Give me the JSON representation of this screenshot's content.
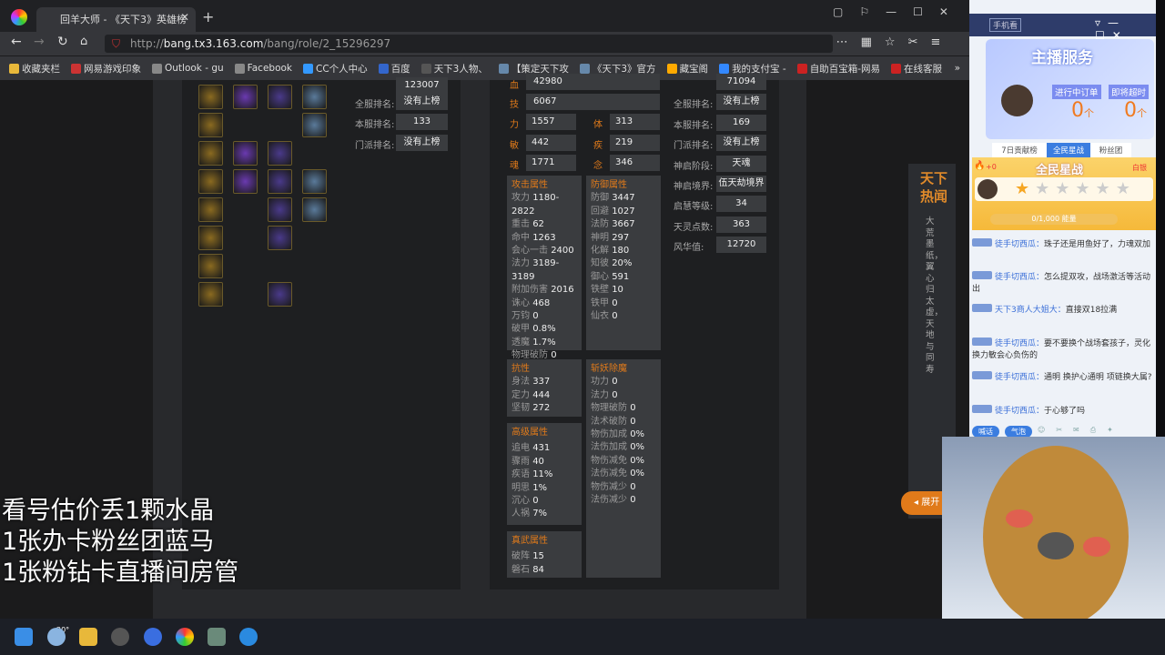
{
  "browser": {
    "tab_title": "回羊大师 - 《天下3》英雄榜",
    "url_prefix": "http://",
    "url_host": "bang.tx3.163.com",
    "url_path": "/bang/role/2_15296297",
    "bookmarks": [
      "收藏夹栏",
      "网易游戏印象",
      "Outlook - gu",
      "Facebook",
      "CC个人中心",
      "百度",
      "天下3人物、",
      "【策定天下攻",
      "《天下3》官方",
      "藏宝阁",
      "我的支付宝 -",
      "自助百宝箱-网易",
      "在线客服"
    ]
  },
  "left_ranks": [
    {
      "label": "",
      "value": "123007"
    },
    {
      "label": "全服排名:",
      "value": "没有上榜"
    },
    {
      "label": "本服排名:",
      "value": "133"
    },
    {
      "label": "门派排名:",
      "value": "没有上榜"
    }
  ],
  "main_stats": {
    "hp": {
      "label": "血",
      "value": "42980"
    },
    "skill": {
      "label": "技",
      "value": "6067"
    },
    "pairs": [
      [
        {
          "label": "力",
          "value": "1557"
        },
        {
          "label": "体",
          "value": "313"
        }
      ],
      [
        {
          "label": "敏",
          "value": "442"
        },
        {
          "label": "疾",
          "value": "219"
        }
      ],
      [
        {
          "label": "魂",
          "value": "1771"
        },
        {
          "label": "念",
          "value": "346"
        }
      ]
    ]
  },
  "right_ranks": [
    {
      "label": "",
      "value": "71094"
    },
    {
      "label": "全服排名:",
      "value": "没有上榜"
    },
    {
      "label": "本服排名:",
      "value": "169"
    },
    {
      "label": "门派排名:",
      "value": "没有上榜"
    },
    {
      "label": "神启阶段:",
      "value": "天魂"
    },
    {
      "label": "神启境界:",
      "value": "伍天劫境界"
    },
    {
      "label": "启慧等级:",
      "value": "34"
    },
    {
      "label": "天灵点数:",
      "value": "363"
    },
    {
      "label": "风华值:",
      "value": "12720"
    }
  ],
  "attack": {
    "title": "攻击属性",
    "rows": [
      [
        "攻力",
        "1180-2822"
      ],
      [
        "重击",
        "62"
      ],
      [
        "命中",
        "1263"
      ],
      [
        "会心一击",
        "2400"
      ],
      [
        "法力",
        "3189-3189"
      ],
      [
        "附加伤害",
        "2016"
      ],
      [
        "诛心",
        "468"
      ],
      [
        "万钧",
        "0"
      ],
      [
        "破甲",
        "0.8%"
      ],
      [
        "透魔",
        "1.7%"
      ],
      [
        "物理破防",
        "0"
      ],
      [
        "法术破防",
        "0"
      ]
    ]
  },
  "defense": {
    "title": "防御属性",
    "rows": [
      [
        "防御",
        "3447"
      ],
      [
        "回避",
        "1027"
      ],
      [
        "法防",
        "3667"
      ],
      [
        "神明",
        "297"
      ],
      [
        "化解",
        "180"
      ],
      [
        "知彼",
        "20%"
      ],
      [
        "御心",
        "591"
      ],
      [
        "铁壁",
        "10"
      ],
      [
        "铁甲",
        "0"
      ],
      [
        "仙衣",
        "0"
      ]
    ]
  },
  "resist": {
    "title": "抗性",
    "rows": [
      [
        "身法",
        "337"
      ],
      [
        "定力",
        "444"
      ],
      [
        "坚韧",
        "272"
      ]
    ]
  },
  "advanced": {
    "title": "高级属性",
    "rows": [
      [
        "追电",
        "431"
      ],
      [
        "骤雨",
        "40"
      ],
      [
        "疾语",
        "11%"
      ],
      [
        "明思",
        "1%"
      ],
      [
        "沉心",
        "0"
      ],
      [
        "人祸",
        "7%"
      ]
    ]
  },
  "zhenwu": {
    "title": "真武属性",
    "rows": [
      [
        "破阵",
        "15"
      ],
      [
        "磐石",
        "84"
      ]
    ]
  },
  "demon": {
    "title": "斩妖除魔",
    "rows": [
      [
        "功力",
        "0"
      ],
      [
        "法力",
        "0"
      ],
      [
        "物理破防",
        "0"
      ],
      [
        "法术破防",
        "0"
      ],
      [
        "物伤加成",
        "0%"
      ],
      [
        "法伤加成",
        "0%"
      ],
      [
        "物伤减免",
        "0%"
      ],
      [
        "法伤减免",
        "0%"
      ],
      [
        "物伤减少",
        "0"
      ],
      [
        "法伤减少",
        "0"
      ]
    ]
  },
  "hot_news": {
    "title1": "天下",
    "title2": "热闻",
    "text": "大荒墨纸，翼心归太虚，天地与同寿",
    "expand": "展开"
  },
  "overlay": [
    "看号估价丢1颗水晶",
    "1张办卡粉丝团蓝马",
    "1张粉钻卡直播间房管"
  ],
  "stream": {
    "topbar": "手机看",
    "service_title": "主播服务",
    "order_in_progress": "进行中订单",
    "order_timeout": "即将超时",
    "count1": "0",
    "count2": "0",
    "unit": "个",
    "tabs": [
      "7日贡献榜",
      "全民星战",
      "粉丝团"
    ],
    "star_title": "全民星战",
    "heat": "+0",
    "rules": "白银",
    "progress": "0/1,000 能量",
    "chat": [
      {
        "user": "徒手切西瓜：",
        "text": "珠子还是用鱼好了，力魂双加"
      },
      {
        "user": "徒手切西瓜：",
        "text": "怎么提双攻，战场激活等活动出"
      },
      {
        "user": "天下3商人大姐大：",
        "text": "直接双18拉满"
      },
      {
        "user": "徒手切西瓜：",
        "text": "要不要换个战场套孩子，灵化换力敏会心负伤的"
      },
      {
        "user": "徒手切西瓜：",
        "text": "通明 换护心通明 项链换大属?"
      },
      {
        "user": "徒手切西瓜：",
        "text": "于心够了吗"
      }
    ],
    "bottom_buttons": [
      "喊话",
      "气泡"
    ]
  },
  "taskbar": {
    "weather": "20°"
  }
}
